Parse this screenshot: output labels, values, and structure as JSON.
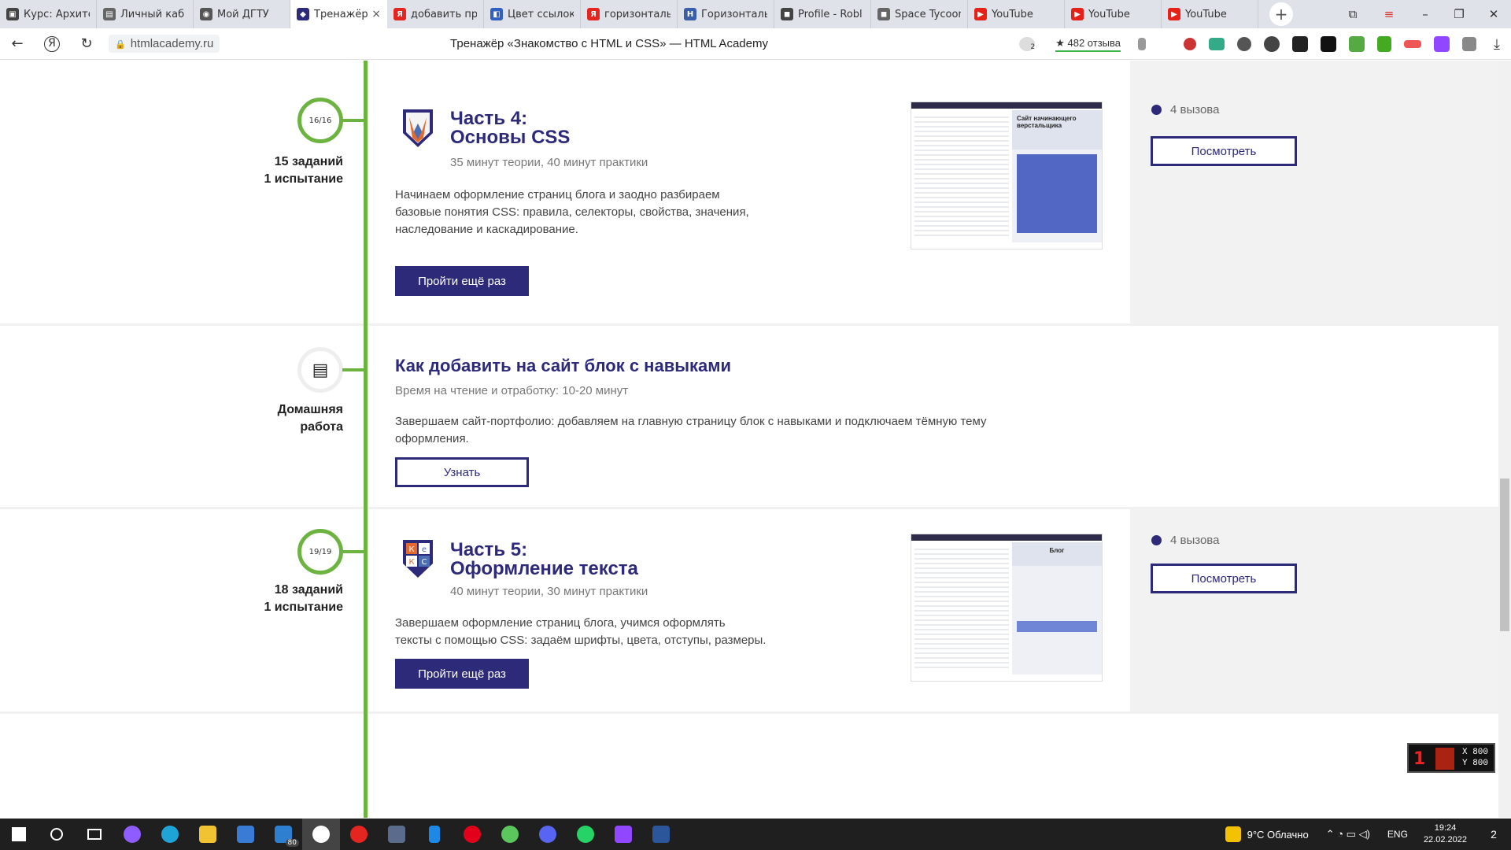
{
  "browser": {
    "tabs": [
      {
        "title": "Курс: Архите",
        "color": "#444"
      },
      {
        "title": "Личный каб",
        "color": "#666"
      },
      {
        "title": "Мой ДГТУ",
        "color": "#555"
      },
      {
        "title": "Тренажёр",
        "color": "#2d2a7a",
        "active": true
      },
      {
        "title": "добавить пр",
        "color": "#e52620"
      },
      {
        "title": "Цвет ссылок",
        "color": "#3060c0"
      },
      {
        "title": "горизонталь",
        "color": "#e52620"
      },
      {
        "title": "Горизонталь",
        "color": "#3a5ea8"
      },
      {
        "title": "Profile - Robl",
        "color": "#444"
      },
      {
        "title": "Space Tycoon",
        "color": "#666"
      },
      {
        "title": "YouTube",
        "color": "#e62117"
      },
      {
        "title": "YouTube",
        "color": "#e62117"
      },
      {
        "title": "YouTube",
        "color": "#e62117"
      }
    ],
    "tab_close": "×",
    "new_tab": "+",
    "window_controls": [
      "⧉",
      "≡",
      "–",
      "❐",
      "✕"
    ],
    "nav": {
      "back": "←",
      "yandex": "Я",
      "reload": "↻"
    },
    "url": "htmlacademy.ru",
    "page_title": "Тренажёр «Знакомство с HTML и CSS» — HTML Academy",
    "reviews": "★ 482 отзыва",
    "badge_count": "2",
    "download_icon": "⤓"
  },
  "timeline": [
    {
      "progress": "16/16",
      "left_line1": "15 заданий",
      "left_line2": "1 испытание",
      "title_line1": "Часть 4:",
      "title_line2": "Основы CSS",
      "meta": "35 минут теории, 40 минут практики",
      "desc_line1": "Начинаем оформление страниц блога и заодно разбираем",
      "desc_line2": "базовые понятия CSS: правила, селекторы, свойства, значения,",
      "desc_line3": "наследование и каскадирование.",
      "button": "Пройти ещё раз",
      "thumb_heading": "Сайт начинающего верстальщика",
      "calls": "4 вызова",
      "view_button": "Посмотреть"
    },
    {
      "left_line1": "Домашняя",
      "left_line2": "работа",
      "title": "Как добавить на сайт блок с навыками",
      "meta": "Время на чтение и отработку: 10-20 минут",
      "desc_line1": "Завершаем сайт-портфолио: добавляем на главную страницу блок с навыками и подключаем тёмную тему",
      "desc_line2": "оформления.",
      "button": "Узнать"
    },
    {
      "progress": "19/19",
      "left_line1": "18 заданий",
      "left_line2": "1 испытание",
      "title_line1": "Часть 5:",
      "title_line2": "Оформление текста",
      "meta": "40 минут теории, 30 минут практики",
      "desc_line1": "Завершаем оформление страниц блога, учимся оформлять",
      "desc_line2": "тексты с помощью CSS: задаём шрифты, цвета, отступы, размеры.",
      "button": "Пройти ещё раз",
      "thumb_heading": "Блог",
      "badge_letters": [
        "К",
        "е",
        "К",
        "С"
      ],
      "calls": "4 вызова",
      "view_button": "Посмотреть"
    }
  ],
  "overlay": {
    "number": "1",
    "x": "X 800",
    "y": "Y 800"
  },
  "taskbar": {
    "mail_count": "80",
    "weather": "9°C  Облачно",
    "lang": "ENG",
    "time": "19:24",
    "date": "22.02.2022",
    "notif_count": "2"
  }
}
